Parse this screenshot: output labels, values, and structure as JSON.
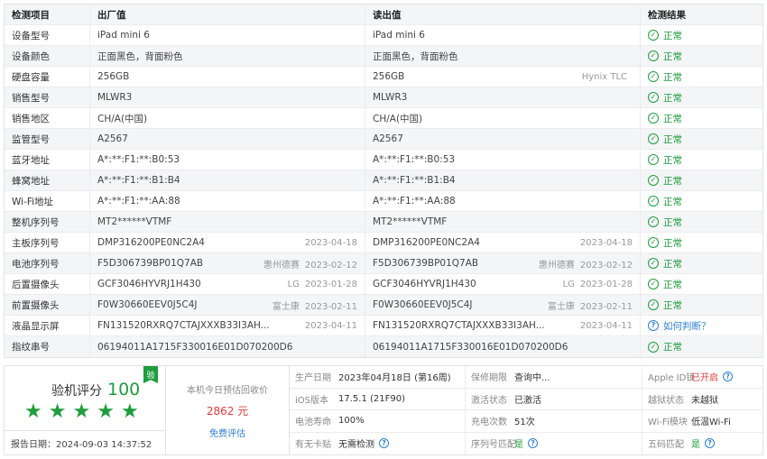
{
  "table": {
    "headers": [
      "检测项目",
      "出厂值",
      "读出值",
      "检测结果"
    ],
    "rows": [
      {
        "item": "设备型号",
        "factory": "iPad mini 6",
        "f_date": "",
        "f_brand": "",
        "read": "iPad mini 6",
        "r_date": "",
        "r_brand": "",
        "result": "正常",
        "status": "ok"
      },
      {
        "item": "设备颜色",
        "factory": "正面黑色，背面粉色",
        "f_date": "",
        "f_brand": "",
        "read": "正面黑色，背面粉色",
        "r_date": "",
        "r_brand": "",
        "result": "正常",
        "status": "ok"
      },
      {
        "item": "硬盘容量",
        "factory": "256GB",
        "f_date": "",
        "f_brand": "",
        "read": "256GB",
        "r_date": "",
        "r_brand": "Hynix TLC",
        "result": "正常",
        "status": "ok"
      },
      {
        "item": "销售型号",
        "factory": "MLWR3",
        "f_date": "",
        "f_brand": "",
        "read": "MLWR3",
        "r_date": "",
        "r_brand": "",
        "result": "正常",
        "status": "ok"
      },
      {
        "item": "销售地区",
        "factory": "CH/A(中国)",
        "f_date": "",
        "f_brand": "",
        "read": "CH/A(中国)",
        "r_date": "",
        "r_brand": "",
        "result": "正常",
        "status": "ok"
      },
      {
        "item": "监管型号",
        "factory": "A2567",
        "f_date": "",
        "f_brand": "",
        "read": "A2567",
        "r_date": "",
        "r_brand": "",
        "result": "正常",
        "status": "ok"
      },
      {
        "item": "蓝牙地址",
        "factory": "A*:**:F1:**:B0:53",
        "f_date": "",
        "f_brand": "",
        "read": "A*:**:F1:**:B0:53",
        "r_date": "",
        "r_brand": "",
        "result": "正常",
        "status": "ok"
      },
      {
        "item": "蜂窝地址",
        "factory": "A*:**:F1:**:B1:B4",
        "f_date": "",
        "f_brand": "",
        "read": "A*:**:F1:**:B1:B4",
        "r_date": "",
        "r_brand": "",
        "result": "正常",
        "status": "ok"
      },
      {
        "item": "Wi-Fi地址",
        "factory": "A*:**:F1:**:AA:88",
        "f_date": "",
        "f_brand": "",
        "read": "A*:**:F1:**:AA:88",
        "r_date": "",
        "r_brand": "",
        "result": "正常",
        "status": "ok"
      },
      {
        "item": "整机序列号",
        "factory": "MT2******VTMF",
        "f_date": "",
        "f_brand": "",
        "read": "MT2******VTMF",
        "r_date": "",
        "r_brand": "",
        "result": "正常",
        "status": "ok"
      },
      {
        "item": "主板序列号",
        "factory": "DMP316200PE0NC2A4",
        "f_date": "2023-04-18",
        "f_brand": "",
        "read": "DMP316200PE0NC2A4",
        "r_date": "2023-04-18",
        "r_brand": "",
        "result": "正常",
        "status": "ok"
      },
      {
        "item": "电池序列号",
        "factory": "F5D306739BP01Q7AB",
        "f_date": "2023-02-12",
        "f_brand": "惠州德赛",
        "read": "F5D306739BP01Q7AB",
        "r_date": "2023-02-12",
        "r_brand": "惠州德赛",
        "result": "正常",
        "status": "ok"
      },
      {
        "item": "后置摄像头",
        "factory": "GCF3046HYVRJ1H430",
        "f_date": "2023-01-28",
        "f_brand": "LG",
        "read": "GCF3046HYVRJ1H430",
        "r_date": "2023-01-28",
        "r_brand": "LG",
        "result": "正常",
        "status": "ok"
      },
      {
        "item": "前置摄像头",
        "factory": "F0W30660EEV0J5C4J",
        "f_date": "2023-02-11",
        "f_brand": "富士康",
        "read": "F0W30660EEV0J5C4J",
        "r_date": "2023-02-11",
        "r_brand": "富士康",
        "result": "正常",
        "status": "ok"
      },
      {
        "item": "液晶显示屏",
        "factory": "FN131520RXRQ7CTAJXXXB33I3AH...",
        "f_date": "2023-04-11",
        "f_brand": "",
        "read": "FN131520RXRQ7CTAJXXXB33I3AH...",
        "r_date": "2023-04-11",
        "r_brand": "",
        "result": "如何判断？",
        "status": "q"
      },
      {
        "item": "指纹串号",
        "factory": "06194011A1715F330016E01D070200D6",
        "f_date": "",
        "f_brand": "",
        "read": "06194011A1715F330016E01D070200D6",
        "r_date": "",
        "r_brand": "",
        "result": "正常",
        "status": "ok"
      }
    ]
  },
  "summary": {
    "score_label": "验机评分",
    "score_value": "100",
    "badge": "验",
    "stars": 5,
    "report_date": "报告日期：2024-09-03 14:37:52",
    "price_label": "本机今日预估回收价",
    "price_value": "2862 元",
    "price_link": "免费评估",
    "info": [
      {
        "k": "生产日期",
        "v": "2023年04月18日 (第16周)",
        "tone": "",
        "help": false
      },
      {
        "k": "保修期限",
        "v": "查询中...",
        "tone": "",
        "help": false
      },
      {
        "k": "Apple ID锁",
        "v": "已开启",
        "tone": "red",
        "help": true
      },
      {
        "k": "iOS版本",
        "v": "17.5.1 (21F90)",
        "tone": "",
        "help": false
      },
      {
        "k": "激活状态",
        "v": "已激活",
        "tone": "",
        "help": false
      },
      {
        "k": "越狱状态",
        "v": "未越狱",
        "tone": "",
        "help": false
      },
      {
        "k": "电池寿命",
        "v": "100%",
        "tone": "",
        "help": false
      },
      {
        "k": "充电次数",
        "v": "51次",
        "tone": "",
        "help": false
      },
      {
        "k": "Wi-Fi模块",
        "v": "低温Wi-Fi",
        "tone": "",
        "help": false
      },
      {
        "k": "有无卡贴",
        "v": "无需检测",
        "tone": "",
        "help": true
      },
      {
        "k": "序列号匹配",
        "v": "是",
        "tone": "green",
        "help": true
      },
      {
        "k": "五码匹配",
        "v": "是",
        "tone": "green",
        "help": true
      }
    ]
  }
}
